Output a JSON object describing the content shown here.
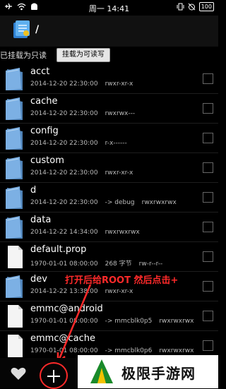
{
  "status_bar": {
    "carrier_day": "周一",
    "time": "14:41",
    "battery": "100",
    "icons": [
      "airplane-icon",
      "wifi-icon",
      "android-icon",
      "vibrate-icon",
      "alarm-off-icon",
      "battery-icon"
    ]
  },
  "header": {
    "path": "/",
    "icon": "app-icon"
  },
  "mount": {
    "status": "已挂载为只读",
    "button": "挂载为可读写"
  },
  "files": [
    {
      "name": "acct",
      "date": "2014-12-20 22:30:00",
      "info": "",
      "perm": "rwxr-xr-x",
      "type": "folder"
    },
    {
      "name": "cache",
      "date": "2014-12-20 22:30:00",
      "info": "",
      "perm": "rwxrwx---",
      "type": "folder"
    },
    {
      "name": "config",
      "date": "2014-12-20 22:30:00",
      "info": "",
      "perm": "r-x------",
      "type": "folder"
    },
    {
      "name": "custom",
      "date": "2014-12-20 22:30:00",
      "info": "",
      "perm": "rwxr-xr-x",
      "type": "folder"
    },
    {
      "name": "d",
      "date": "2014-12-20 22:30:00",
      "info": "-> debug",
      "perm": "rwxrwxrwx",
      "type": "folder-link"
    },
    {
      "name": "data",
      "date": "2014-12-22 14:34:00",
      "info": "",
      "perm": "rwxrwxrwx",
      "type": "folder"
    },
    {
      "name": "default.prop",
      "date": "1970-01-01 08:00:00",
      "info": "268 字节",
      "perm": "rw-r--r--",
      "type": "file"
    },
    {
      "name": "dev",
      "date": "2014-12-22 13:38:00",
      "info": "",
      "perm": "rwxr-xr-x",
      "type": "folder"
    },
    {
      "name": "emmc@android",
      "date": "1970-01-01 08:00:00",
      "info": "-> mmcblk0p5",
      "perm": "rwxrwxrwx",
      "type": "file-link"
    },
    {
      "name": "emmc@cache",
      "date": "1970-01-01 08:00:00",
      "info": "-> mmcblk0p6",
      "perm": "rwxrwxrwx",
      "type": "file-link"
    }
  ],
  "annotation": "打开后给ROOT 然后点击+",
  "bottom": {
    "heart_icon": "heart-icon",
    "add_icon": "plus-icon"
  },
  "watermark": {
    "text": "极限手游网"
  },
  "colors": {
    "accent_red": "#ff2a2a",
    "folder_blue": "#6a9fd8"
  }
}
